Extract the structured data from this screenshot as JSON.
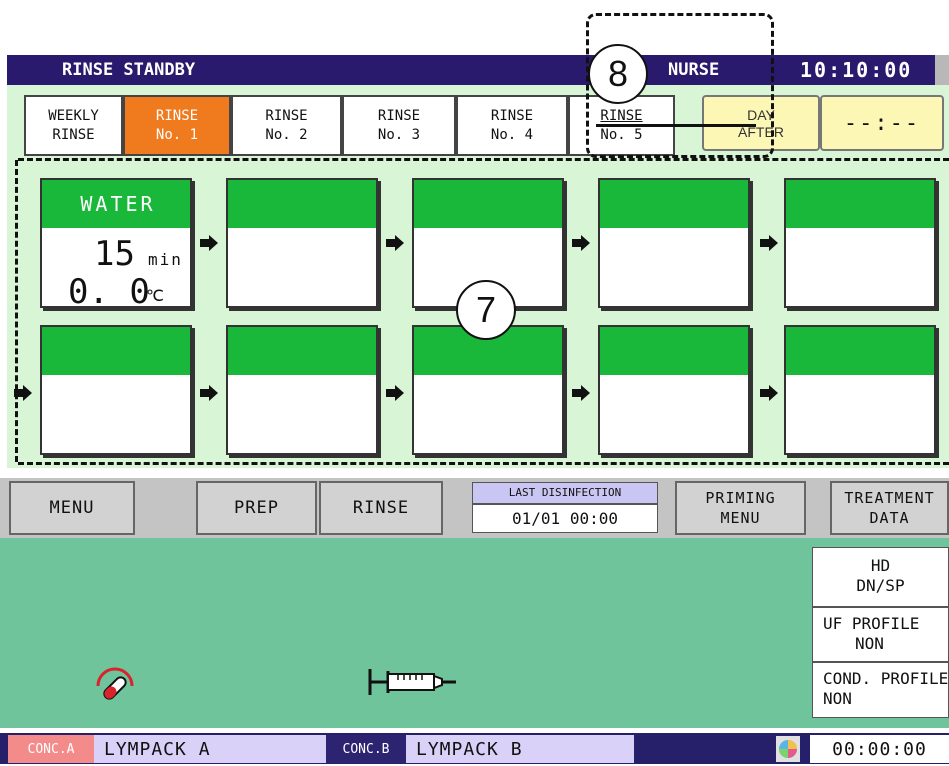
{
  "header": {
    "title": "RINSE STANDBY",
    "user": "NURSE",
    "time": "10:10:00"
  },
  "tabs": [
    {
      "line1": "WEEKLY",
      "line2": "RINSE"
    },
    {
      "line1": "RINSE",
      "line2": "No. 1"
    },
    {
      "line1": "RINSE",
      "line2": "No. 2"
    },
    {
      "line1": "RINSE",
      "line2": "No. 3"
    },
    {
      "line1": "RINSE",
      "line2": "No. 4"
    },
    {
      "line1": "RINSE",
      "line2": "No. 5"
    }
  ],
  "schedule": {
    "day_line1": "DAY",
    "day_line2": "AFTER",
    "time": "--:--"
  },
  "steps": {
    "first": {
      "name": "WATER",
      "duration_value": "15",
      "duration_unit": "min",
      "temp_value": "0. 0",
      "temp_unit": "℃"
    }
  },
  "callouts": {
    "c7": "7",
    "c8": "8"
  },
  "menu": {
    "menu": "MENU",
    "prep": "PREP",
    "rinse": "RINSE",
    "last_disinfection_label": "LAST DISINFECTION",
    "last_disinfection_value": "01/01 00:00",
    "priming_line1": "PRIMING",
    "priming_line2": "MENU",
    "treatment_line1": "TREATMENT",
    "treatment_line2": "DATA"
  },
  "side_panel": {
    "mode_line1": "HD",
    "mode_line2": "DN/SP",
    "uf_label": "UF PROFILE",
    "uf_value": "NON",
    "cond_label": "COND. PROFILE",
    "cond_value": "NON"
  },
  "bottom": {
    "conc_a_label": "CONC.A",
    "conc_a_value": "LYMPACK A",
    "conc_b_label": "CONC.B",
    "conc_b_value": "LYMPACK B",
    "elapsed": "00:00:00"
  },
  "colors": {
    "title_bar": "#2a1a6e",
    "active_tab": "#f07a1e",
    "step_header": "#19b73a",
    "panel_bg": "#d8f5d5",
    "status_bg": "#6fc49c"
  }
}
